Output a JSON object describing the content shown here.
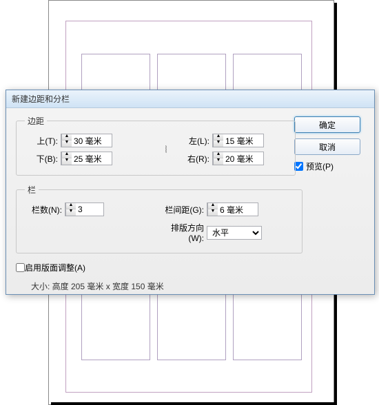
{
  "dialog_title": "新建边距和分栏",
  "groups": {
    "margins": "边距",
    "columns": "栏"
  },
  "margins": {
    "top_label": "上(T):",
    "top_value": "30 毫米",
    "bottom_label": "下(B):",
    "bottom_value": "25 毫米",
    "left_label": "左(L):",
    "left_value": "15 毫米",
    "right_label": "右(R):",
    "right_value": "20 毫米"
  },
  "columns": {
    "number_label": "栏数(N):",
    "number_value": "3",
    "gutter_label": "栏间距(G):",
    "gutter_value": "6 毫米",
    "direction_label": "排版方向(W):",
    "direction_value": "水平"
  },
  "buttons": {
    "ok": "确定",
    "cancel": "取消"
  },
  "preview": {
    "label": "预览(P)",
    "checked": true
  },
  "layout_adjust": {
    "label": "启用版面调整(A)",
    "checked": false
  },
  "size_line": "大小: 高度 205 毫米 x 宽度 150 毫米"
}
